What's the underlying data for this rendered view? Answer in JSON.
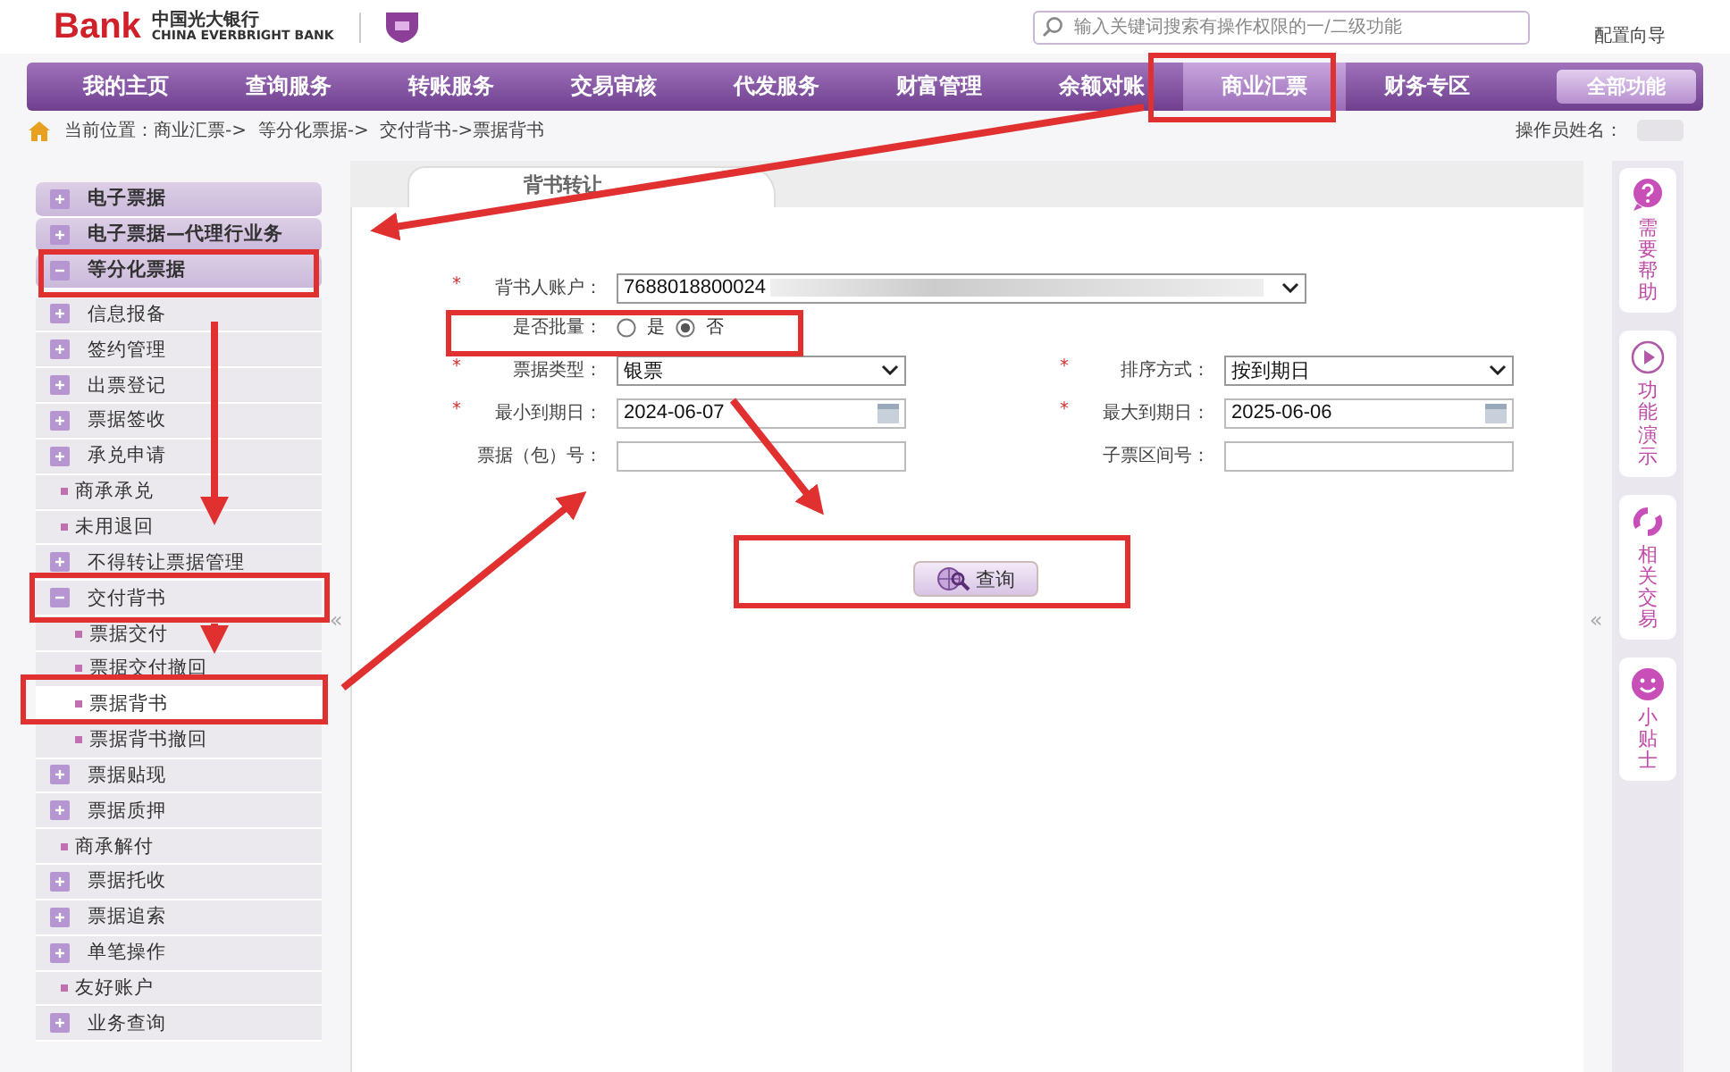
{
  "header": {
    "logo_text": "Bank",
    "bank_name": "中国光大银行",
    "bank_name_en": "CHINA EVERBRIGHT BANK",
    "search": {
      "placeholder": "输入关键词搜索有操作权限的一/二级功能"
    },
    "setup_link": "配置向导"
  },
  "nav": {
    "items": [
      {
        "label": "我的主页",
        "selected": false
      },
      {
        "label": "查询服务",
        "selected": false
      },
      {
        "label": "转账服务",
        "selected": false
      },
      {
        "label": "交易审核",
        "selected": false
      },
      {
        "label": "代发服务",
        "selected": false
      },
      {
        "label": "财富管理",
        "selected": false
      },
      {
        "label": "余额对账",
        "selected": false
      },
      {
        "label": "商业汇票",
        "selected": true
      },
      {
        "label": "财务专区",
        "selected": false
      }
    ],
    "all_button": "全部功能"
  },
  "breadcrumb": "当前位置：商业汇票->  等分化票据->  交付背书->票据背书",
  "operator_label": "操作员姓名：",
  "sidebar": {
    "collapse": "«",
    "items": [
      {
        "label": "电子票据",
        "kind": "group",
        "expanded": false,
        "selected": false
      },
      {
        "label": "电子票据—代理行业务",
        "kind": "group",
        "expanded": false,
        "selected": false
      },
      {
        "label": "等分化票据",
        "kind": "group",
        "expanded": true,
        "selected": false,
        "children": [
          {
            "label": "信息报备",
            "kind": "folder",
            "expanded": false,
            "selected": false
          },
          {
            "label": "签约管理",
            "kind": "folder",
            "expanded": false,
            "selected": false
          },
          {
            "label": "出票登记",
            "kind": "folder",
            "expanded": false,
            "selected": false
          },
          {
            "label": "票据签收",
            "kind": "folder",
            "expanded": false,
            "selected": false
          },
          {
            "label": "承兑申请",
            "kind": "folder",
            "expanded": false,
            "selected": false
          },
          {
            "label": "商承承兑",
            "kind": "leaf",
            "selected": false
          },
          {
            "label": "未用退回",
            "kind": "leaf",
            "selected": false
          },
          {
            "label": "不得转让票据管理",
            "kind": "folder",
            "expanded": false,
            "selected": false
          },
          {
            "label": "交付背书",
            "kind": "folder",
            "expanded": true,
            "selected": false,
            "children": [
              {
                "label": "票据交付",
                "kind": "leaf",
                "selected": false
              },
              {
                "label": "票据交付撤回",
                "kind": "leaf",
                "selected": false
              },
              {
                "label": "票据背书",
                "kind": "leaf",
                "selected": true
              },
              {
                "label": "票据背书撤回",
                "kind": "leaf",
                "selected": false
              }
            ]
          },
          {
            "label": "票据贴现",
            "kind": "folder",
            "expanded": false,
            "selected": false
          },
          {
            "label": "票据质押",
            "kind": "folder",
            "expanded": false,
            "selected": false
          },
          {
            "label": "商承解付",
            "kind": "leaf",
            "selected": false
          },
          {
            "label": "票据托收",
            "kind": "folder",
            "expanded": false,
            "selected": false
          },
          {
            "label": "票据追索",
            "kind": "folder",
            "expanded": false,
            "selected": false
          },
          {
            "label": "单笔操作",
            "kind": "folder",
            "expanded": false,
            "selected": false
          },
          {
            "label": "友好账户",
            "kind": "leaf",
            "selected": false
          },
          {
            "label": "业务查询",
            "kind": "folder",
            "expanded": false,
            "selected": false
          }
        ]
      }
    ]
  },
  "form": {
    "tab": "背书转让",
    "account": {
      "label": "背书人账户：",
      "mark": "*",
      "value": "7688018800024"
    },
    "batch": {
      "label": "是否批量：",
      "options": [
        {
          "label": "是",
          "selected": false
        },
        {
          "label": "否",
          "selected": true
        }
      ]
    },
    "fields": [
      {
        "label": "票据类型：",
        "mark": "*",
        "kind": "select",
        "value": "银票"
      },
      {
        "label": "排序方式：",
        "mark": "*",
        "kind": "select",
        "value": "按到期日"
      },
      {
        "label": "最小到期日：",
        "mark": "*",
        "kind": "date",
        "value": "2024-06-07"
      },
      {
        "label": "最大到期日：",
        "mark": "*",
        "kind": "date",
        "value": "2025-06-06"
      },
      {
        "label": "票据（包）号：",
        "kind": "text"
      },
      {
        "label": "子票区间号：",
        "kind": "text"
      }
    ],
    "query_button": "查询"
  },
  "right_collapse": "«",
  "toolbar": [
    {
      "label": "需要帮助",
      "kind": "help"
    },
    {
      "label": "功能演示",
      "kind": "play"
    },
    {
      "label": "相关交易",
      "kind": "swap"
    },
    {
      "label": "小贴士",
      "kind": "smile"
    }
  ],
  "annotations": {
    "visible": true
  }
}
